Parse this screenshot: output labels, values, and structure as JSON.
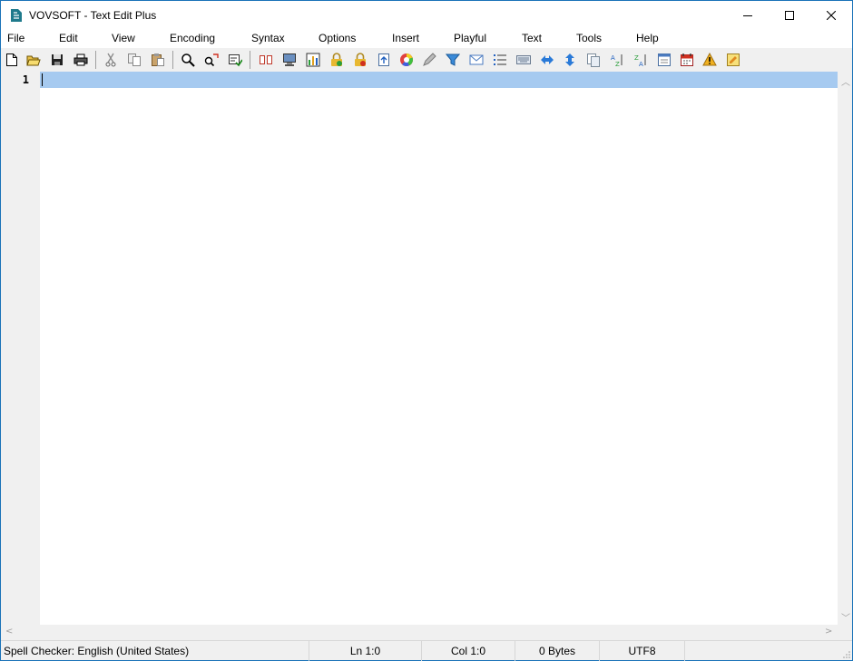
{
  "window": {
    "title": "VOVSOFT - Text Edit Plus",
    "controls": [
      "minimize-icon",
      "maximize-icon",
      "close-icon"
    ]
  },
  "menu": {
    "items": [
      "File",
      "Edit",
      "View",
      "Encoding",
      "Syntax",
      "Options",
      "Insert",
      "Playful",
      "Text",
      "Tools",
      "Help"
    ]
  },
  "toolbar": {
    "buttons": [
      "new-icon",
      "open-icon",
      "save-icon",
      "print-icon",
      "cut-icon",
      "copy-icon",
      "paste-icon",
      "find-icon",
      "replace-icon",
      "goto-icon",
      "book-icon",
      "monitor-icon",
      "chart-icon",
      "lock-green-icon",
      "lock-red-icon",
      "export-icon",
      "color-wheel-icon",
      "pen-icon",
      "filter-icon",
      "email-icon",
      "list-icon",
      "keyboard-icon",
      "horizontal-arrows-icon",
      "vertical-arrows-icon",
      "documents-icon",
      "sort-az-icon",
      "sort-za-icon",
      "window-icon",
      "calendar-icon",
      "warning-icon",
      "note-icon"
    ]
  },
  "editor": {
    "line_numbers": [
      "1"
    ],
    "content": ""
  },
  "status": {
    "spell_checker": "Spell Checker: English (United States)",
    "line": "Ln 1:0",
    "column": "Col 1:0",
    "size": "0 Bytes",
    "encoding": "UTF8"
  },
  "colors": {
    "window_border": "#1a73b8",
    "current_line": "#a6caf0",
    "chrome": "#f0f0f0"
  }
}
